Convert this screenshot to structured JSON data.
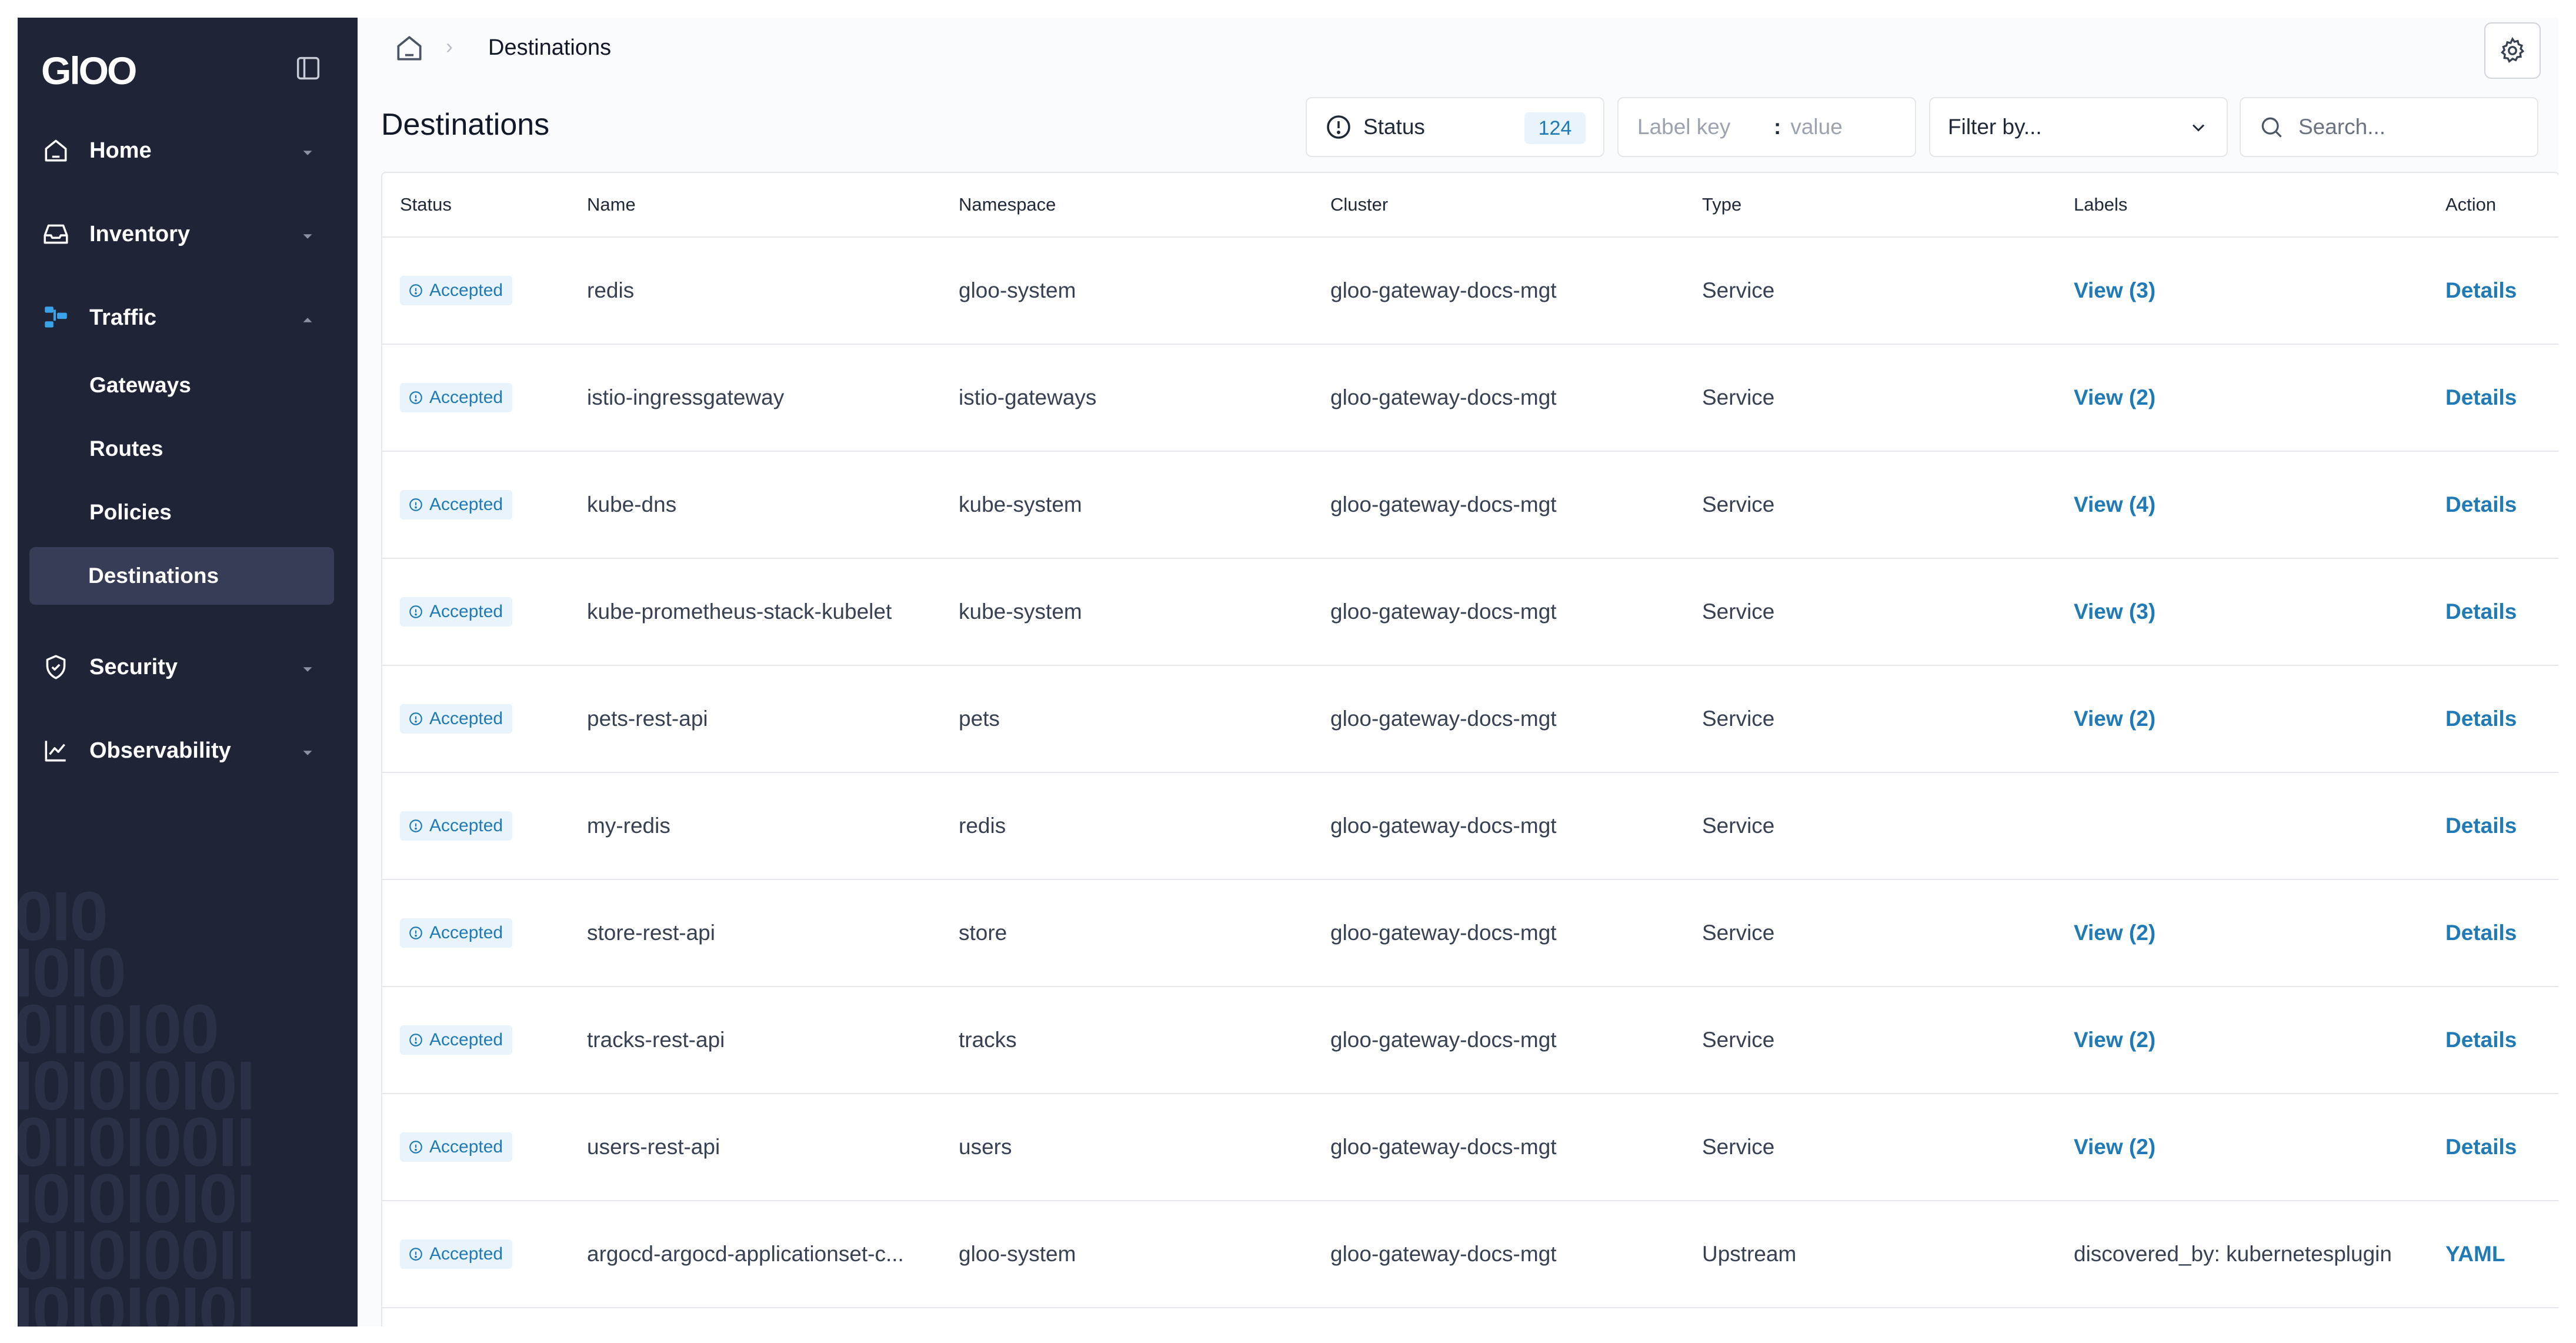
{
  "app": {
    "logo_text": "GlOO"
  },
  "sidebar": {
    "items": [
      {
        "label": "Home",
        "icon": "home-icon",
        "expanded": false
      },
      {
        "label": "Inventory",
        "icon": "inbox-icon",
        "expanded": false
      },
      {
        "label": "Traffic",
        "icon": "traffic-icon",
        "expanded": true,
        "children": [
          {
            "label": "Gateways",
            "active": false
          },
          {
            "label": "Routes",
            "active": false
          },
          {
            "label": "Policies",
            "active": false
          },
          {
            "label": "Destinations",
            "active": true
          }
        ]
      },
      {
        "label": "Security",
        "icon": "shield-icon",
        "expanded": false
      },
      {
        "label": "Observability",
        "icon": "chart-icon",
        "expanded": false
      }
    ]
  },
  "breadcrumb": {
    "current": "Destinations"
  },
  "page": {
    "title": "Destinations"
  },
  "filters": {
    "status_label": "Status",
    "status_count": "124",
    "label_key_placeholder": "Label key",
    "label_separator": ":",
    "label_value_placeholder": "value",
    "filter_by_label": "Filter by...",
    "search_placeholder": "Search..."
  },
  "table": {
    "columns": [
      "Status",
      "Name",
      "Namespace",
      "Cluster",
      "Type",
      "Labels",
      "Action"
    ],
    "rows": [
      {
        "status": "Accepted",
        "name": "redis",
        "namespace": "gloo-system",
        "cluster": "gloo-gateway-docs-mgt",
        "type": "Service",
        "labels": "View (3)",
        "labels_link": true,
        "action": "Details"
      },
      {
        "status": "Accepted",
        "name": "istio-ingressgateway",
        "namespace": "istio-gateways",
        "cluster": "gloo-gateway-docs-mgt",
        "type": "Service",
        "labels": "View (2)",
        "labels_link": true,
        "action": "Details"
      },
      {
        "status": "Accepted",
        "name": "kube-dns",
        "namespace": "kube-system",
        "cluster": "gloo-gateway-docs-mgt",
        "type": "Service",
        "labels": "View (4)",
        "labels_link": true,
        "action": "Details"
      },
      {
        "status": "Accepted",
        "name": "kube-prometheus-stack-kubelet",
        "namespace": "kube-system",
        "cluster": "gloo-gateway-docs-mgt",
        "type": "Service",
        "labels": "View (3)",
        "labels_link": true,
        "action": "Details"
      },
      {
        "status": "Accepted",
        "name": "pets-rest-api",
        "namespace": "pets",
        "cluster": "gloo-gateway-docs-mgt",
        "type": "Service",
        "labels": "View (2)",
        "labels_link": true,
        "action": "Details"
      },
      {
        "status": "Accepted",
        "name": "my-redis",
        "namespace": "redis",
        "cluster": "gloo-gateway-docs-mgt",
        "type": "Service",
        "labels": "",
        "labels_link": false,
        "action": "Details"
      },
      {
        "status": "Accepted",
        "name": "store-rest-api",
        "namespace": "store",
        "cluster": "gloo-gateway-docs-mgt",
        "type": "Service",
        "labels": "View (2)",
        "labels_link": true,
        "action": "Details"
      },
      {
        "status": "Accepted",
        "name": "tracks-rest-api",
        "namespace": "tracks",
        "cluster": "gloo-gateway-docs-mgt",
        "type": "Service",
        "labels": "View (2)",
        "labels_link": true,
        "action": "Details"
      },
      {
        "status": "Accepted",
        "name": "users-rest-api",
        "namespace": "users",
        "cluster": "gloo-gateway-docs-mgt",
        "type": "Service",
        "labels": "View (2)",
        "labels_link": true,
        "action": "Details"
      },
      {
        "status": "Accepted",
        "name": "argocd-argocd-applicationset-c...",
        "namespace": "gloo-system",
        "cluster": "gloo-gateway-docs-mgt",
        "type": "Upstream",
        "labels": "discovered_by: kubernetesplugin",
        "labels_link": false,
        "action": "YAML"
      }
    ]
  },
  "colors": {
    "sidebar_bg": "#1f2436",
    "sidebar_active": "#373d57",
    "accent": "#1f7ab6",
    "badge_bg": "#e8f3fb",
    "traffic_icon": "#3aa3e8"
  }
}
